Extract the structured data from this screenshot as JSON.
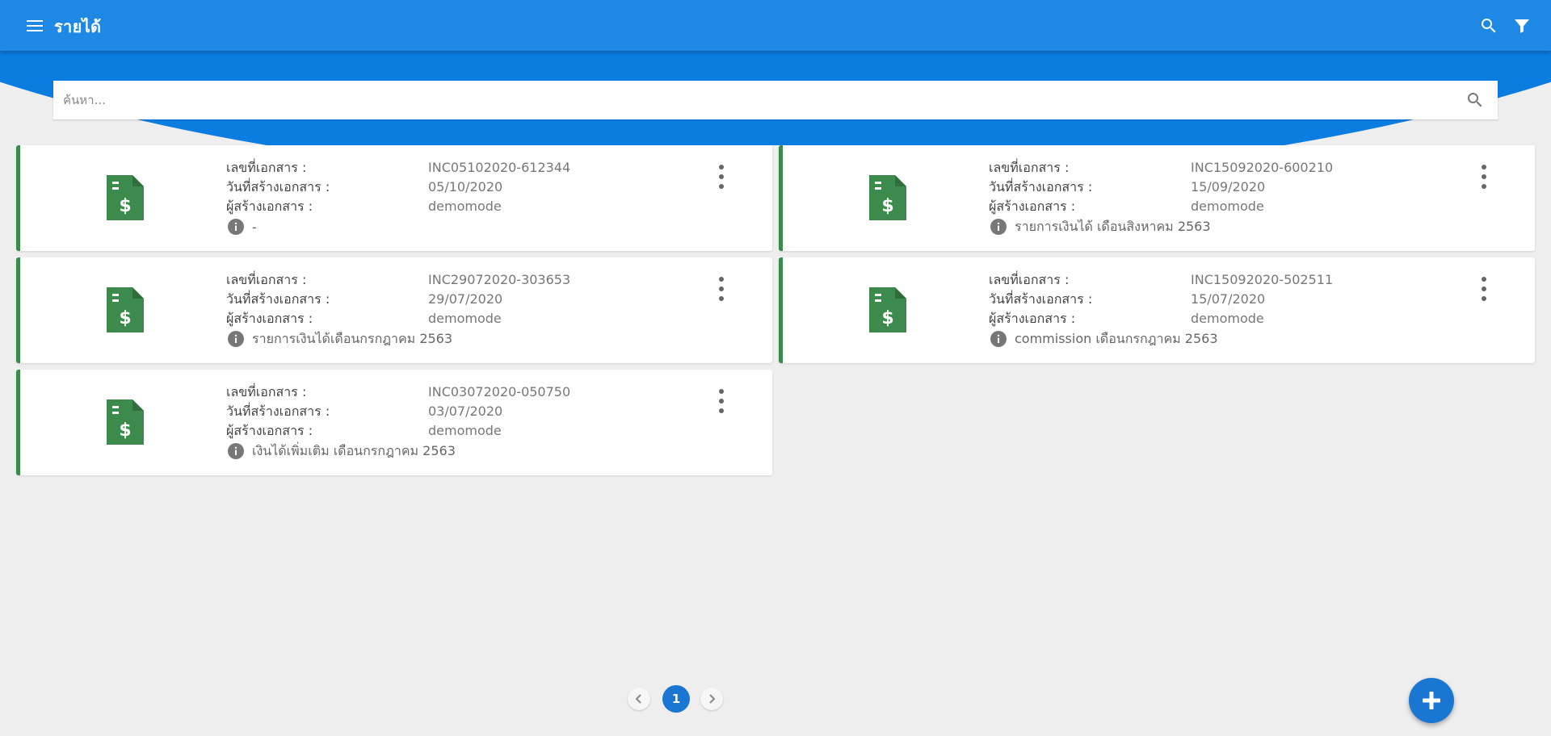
{
  "header": {
    "title": "รายได้",
    "menu_icon": "hamburger-icon",
    "search_icon": "search-icon",
    "filter_icon": "filter-icon"
  },
  "search": {
    "placeholder": "ค้นหา...",
    "value": ""
  },
  "card_labels": {
    "doc_no": "เลขที่เอกสาร :",
    "created_date": "วันที่สร้างเอกสาร :",
    "creator": "ผู้สร้างเอกสาร :"
  },
  "cards": [
    {
      "doc_no": "INC05102020-612344",
      "created_date": "05/10/2020",
      "creator": "demomode",
      "note": "-"
    },
    {
      "doc_no": "INC15092020-600210",
      "created_date": "15/09/2020",
      "creator": "demomode",
      "note": "รายการเงินได้ เดือนสิงหาคม 2563"
    },
    {
      "doc_no": "INC29072020-303653",
      "created_date": "29/07/2020",
      "creator": "demomode",
      "note": "รายการเงินได้เดือนกรกฎาคม 2563"
    },
    {
      "doc_no": "INC15092020-502511",
      "created_date": "15/07/2020",
      "creator": "demomode",
      "note": "commission เดือนกรกฎาคม 2563"
    },
    {
      "doc_no": "INC03072020-050750",
      "created_date": "03/07/2020",
      "creator": "demomode",
      "note": "เงินได้เพิ่มเติม เดือนกรกฎาคม 2563"
    }
  ],
  "pagination": {
    "current_page": "1"
  },
  "colors": {
    "primary": "#1e88e5",
    "accent_band": "#0b7ce0",
    "card_accent": "#3d8b4c",
    "fab": "#1976d2"
  }
}
